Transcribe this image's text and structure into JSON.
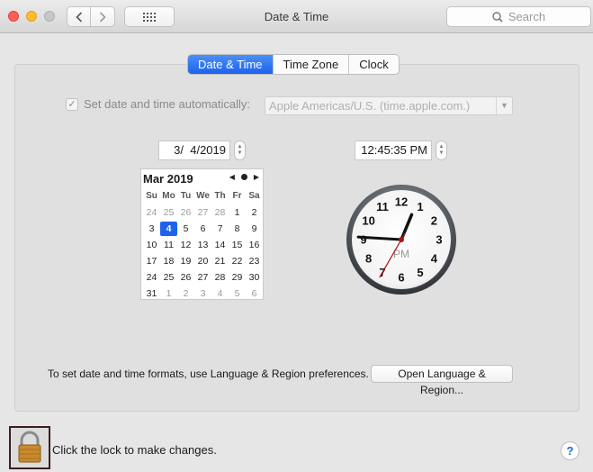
{
  "window": {
    "title": "Date & Time",
    "search_placeholder": "Search"
  },
  "tabs": [
    {
      "label": "Date & Time",
      "active": true
    },
    {
      "label": "Time Zone",
      "active": false
    },
    {
      "label": "Clock",
      "active": false
    }
  ],
  "auto": {
    "label": "Set date and time automatically:",
    "checked": true,
    "server": "Apple Americas/U.S. (time.apple.com.)"
  },
  "date_field": "3/  4/2019",
  "time_field": "12:45:35 PM",
  "calendar": {
    "month_label": "Mar 2019",
    "weekdays": [
      "Su",
      "Mo",
      "Tu",
      "We",
      "Th",
      "Fr",
      "Sa"
    ],
    "weeks": [
      [
        "24",
        "25",
        "26",
        "27",
        "28",
        "1",
        "2"
      ],
      [
        "3",
        "4",
        "5",
        "6",
        "7",
        "8",
        "9"
      ],
      [
        "10",
        "11",
        "12",
        "13",
        "14",
        "15",
        "16"
      ],
      [
        "17",
        "18",
        "19",
        "20",
        "21",
        "22",
        "23"
      ],
      [
        "24",
        "25",
        "26",
        "27",
        "28",
        "29",
        "30"
      ],
      [
        "31",
        "1",
        "2",
        "3",
        "4",
        "5",
        "6"
      ]
    ],
    "selected_day": "4"
  },
  "clock": {
    "numbers": [
      "12",
      "1",
      "2",
      "3",
      "4",
      "5",
      "6",
      "7",
      "8",
      "9",
      "10",
      "11"
    ],
    "ampm": "PM",
    "hour": 12,
    "minute": 45,
    "second": 35
  },
  "formats_text": "To set date and time formats, use Language & Region preferences.",
  "open_language_button": "Open Language & Region...",
  "lock_text": "Click the lock to make changes.",
  "help_label": "?",
  "colors": {
    "accent": "#1d63ed",
    "second_hand": "#b01010"
  }
}
